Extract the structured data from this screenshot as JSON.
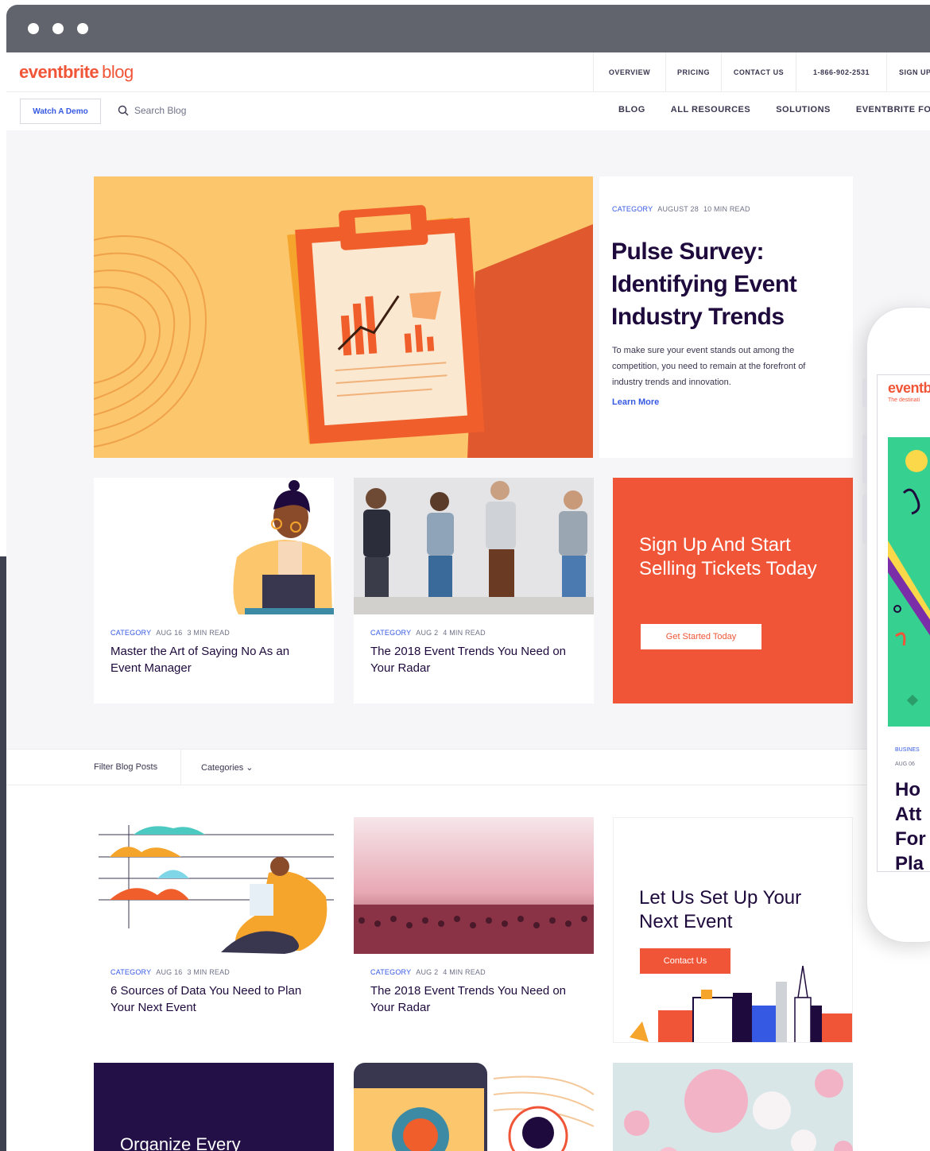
{
  "browser": {
    "window_dots": 3
  },
  "header": {
    "logo": "eventbrite",
    "logo_suffix": "blog",
    "top_nav": [
      "OVERVIEW",
      "PRICING",
      "CONTACT US",
      "1-866-902-2531",
      "SIGN UP"
    ],
    "demo_button": "Watch A Demo",
    "search_placeholder": "Search Blog",
    "main_nav": [
      "BLOG",
      "ALL RESOURCES",
      "SOLUTIONS",
      "EVENTBRITE FOR"
    ]
  },
  "hero": {
    "category": "CATEGORY",
    "date": "AUGUST 28",
    "read_time": "10 MIN READ",
    "title": "Pulse Survey: Identifying Event Industry Trends",
    "description": "To make sure your event stands out among the competition, you need to remain at the forefront of industry trends and innovation.",
    "link": "Learn More"
  },
  "cards_row1": [
    {
      "category": "CATEGORY",
      "date": "AUG 16",
      "read_time": "3 MIN READ",
      "title": "Master the Art of Saying No As an Event Manager"
    },
    {
      "category": "CATEGORY",
      "date": "AUG 2",
      "read_time": "4 MIN READ",
      "title": "The 2018 Event Trends You Need on Your Radar"
    }
  ],
  "promo_signup": {
    "title": "Sign Up And Start Selling Tickets Today",
    "button": "Get Started Today"
  },
  "filter": {
    "label": "Filter Blog Posts",
    "dropdown": "Categories"
  },
  "cards_row2": [
    {
      "category": "CATEGORY",
      "date": "AUG 16",
      "read_time": "3 MIN READ",
      "title": "6 Sources of Data You Need to Plan Your Next Event"
    },
    {
      "category": "CATEGORY",
      "date": "AUG 2",
      "read_time": "4 MIN READ",
      "title": "The 2018 Event Trends You Need on Your Radar"
    }
  ],
  "promo_contact": {
    "title": "Let Us Set Up Your Next Event",
    "button": "Contact Us"
  },
  "dark_card": {
    "title": "Organize Every"
  },
  "phone": {
    "logo": "eventb",
    "tagline": "The destinati",
    "category": "BUSINES",
    "date": "AUG 06",
    "title": "Ho\nAtt\nFor\nPla"
  },
  "colors": {
    "brand": "#f05537",
    "link": "#3659e3",
    "heading": "#1e0a3c",
    "hero_bg": "#fbc66c",
    "dark_card": "#221046"
  }
}
